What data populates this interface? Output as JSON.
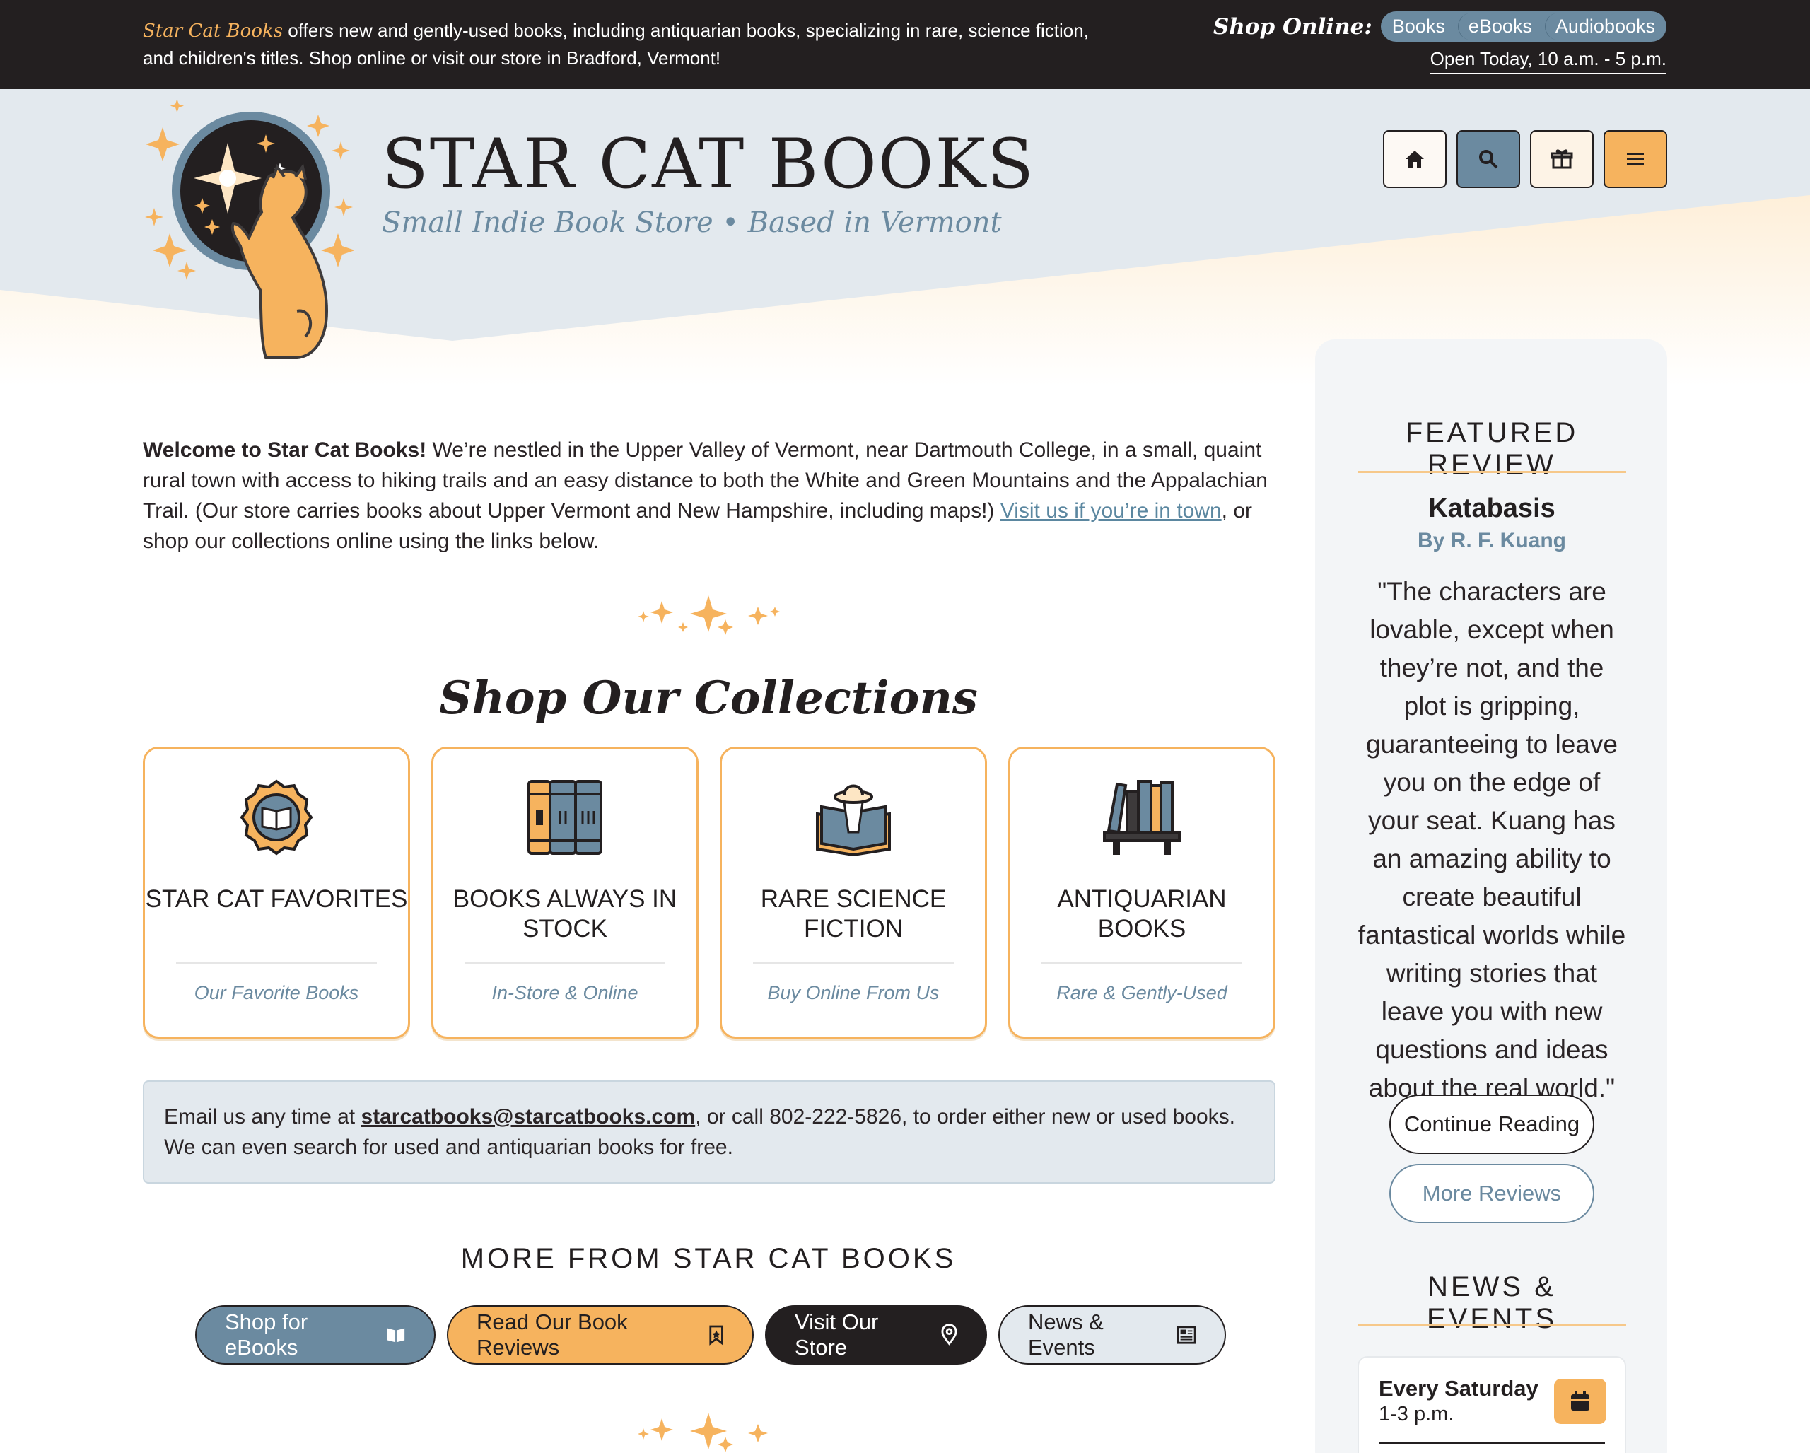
{
  "topbar": {
    "brand": "Star Cat Books",
    "intro": " offers new and gently-used books, including antiquarian books, specializing in rare, science fiction, and children's titles. Shop online or visit our store in Bradford, Vermont!",
    "shop_label": "Shop Online:",
    "shop_links": [
      "Books",
      "eBooks",
      "Audiobooks"
    ],
    "hours": "Open Today, 10 a.m. - 5 p.m."
  },
  "header": {
    "title": "STAR CAT BOOKS",
    "tagline": "Small Indie Book Store • Based in Vermont",
    "buttons": [
      {
        "name": "home",
        "icon": "home-icon",
        "color": "#fdf3e6"
      },
      {
        "name": "search",
        "icon": "search-icon",
        "color": "#6b8aa0"
      },
      {
        "name": "gift",
        "icon": "gift-icon",
        "color": "#fdf3e6"
      },
      {
        "name": "menu",
        "icon": "menu-icon",
        "color": "#f6b35e"
      }
    ]
  },
  "welcome": {
    "bold": "Welcome to Star Cat Books!",
    "text1": " We’re nestled in the Upper Valley of Vermont, near Dartmouth College, in a small, quaint rural town with access to hiking trails and an easy distance to both the White and Green Mountains and the Appalachian Trail. (Our store carries books about Upper Vermont and New Hampshire, including maps!) ",
    "link": "Visit us if you’re in town",
    "text2": ", or shop our collections online using the links below."
  },
  "collections": {
    "title": "Shop Our Collections",
    "cards": [
      {
        "title": "STAR CAT FAVORITES",
        "sub": "Our Favorite Books",
        "icon": "badge-book-icon"
      },
      {
        "title": "BOOKS ALWAYS IN STOCK",
        "sub": "In-Store & Online",
        "icon": "books-stack-icon"
      },
      {
        "title": "RARE SCIENCE FICTION",
        "sub": "Buy Online From Us",
        "icon": "ufo-book-icon"
      },
      {
        "title": "ANTIQUARIAN BOOKS",
        "sub": "Rare & Gently-Used",
        "icon": "bookshelf-icon"
      }
    ]
  },
  "contact": {
    "pre": "Email us any time at ",
    "email": "starcatbooks@starcatbooks.com",
    "post": ", or call 802-222-5826, to order either new or used books. We can even search for used and antiquarian books for free."
  },
  "more": {
    "title": "MORE FROM STAR CAT BOOKS",
    "buttons": [
      {
        "label": "Shop for eBooks",
        "icon": "book-open-icon",
        "bg": "#6b8aa0",
        "fg": "#ffffff"
      },
      {
        "label": "Read Our Book Reviews",
        "icon": "bookmark-icon",
        "bg": "#f6b35e",
        "fg": "#231f20"
      },
      {
        "label": "Visit Our Store",
        "icon": "map-pin-icon",
        "bg": "#231f20",
        "fg": "#ffffff"
      },
      {
        "label": "News & Events",
        "icon": "newspaper-icon",
        "bg": "#e3e9ee",
        "fg": "#231f20"
      }
    ]
  },
  "sidebar": {
    "featured_heading": "FEATURED REVIEW",
    "review_title": "Katabasis",
    "review_author": "By R. F. Kuang",
    "review_quote": "\"The characters are lovable, except when they’re not, and the plot is gripping, guaranteeing to leave you on the edge of your seat. Kuang has an amazing ability to create beautiful fantastical worlds while writing stories that leave you with new questions and ideas about the real world.\"",
    "continue_label": "Continue Reading",
    "more_reviews_label": "More Reviews",
    "news_heading": "NEWS & EVENTS",
    "event_when": "Every Saturday",
    "event_time": "1-3 p.m."
  },
  "colors": {
    "accent": "#f6b35e",
    "slate": "#6b8aa0",
    "dark": "#231f20",
    "header_bg": "#e3e9ee"
  }
}
